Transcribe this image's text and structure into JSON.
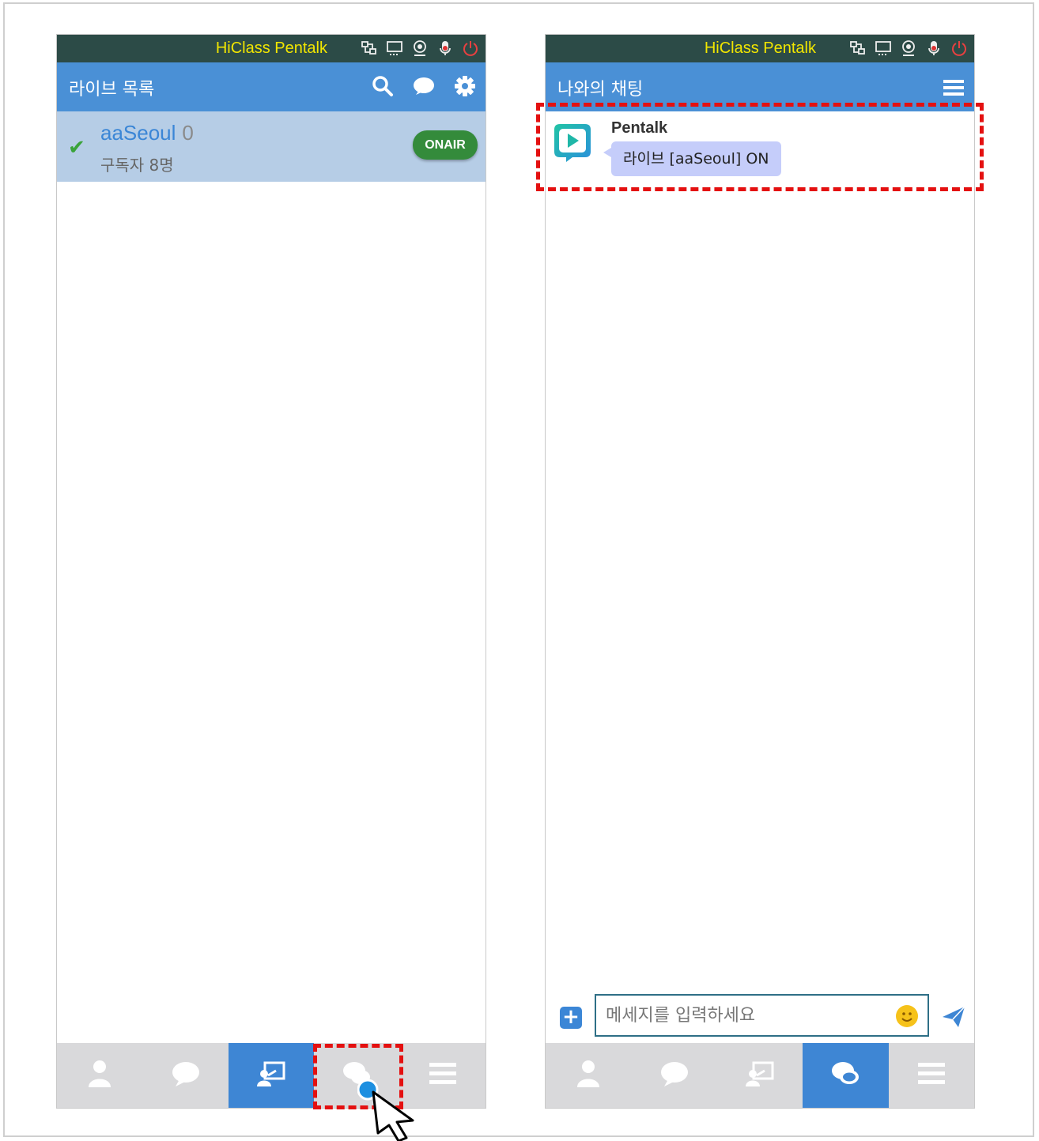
{
  "left_panel": {
    "app_title": "HiClass Pentalk",
    "header_title": "라이브 목록",
    "live_items": [
      {
        "name": "aaSeoul",
        "count": "0",
        "subscribers": "구독자 8명",
        "badge": "ONAIR"
      }
    ],
    "nav": [
      "person-icon",
      "chat-bubble-icon",
      "live-board-icon",
      "chat-icon",
      "menu-icon"
    ],
    "active_nav": "live-board-icon"
  },
  "right_panel": {
    "app_title": "HiClass Pentalk",
    "header_title": "나와의 채팅",
    "messages": [
      {
        "sender": "Pentalk",
        "text": "라이브 [aaSeoul] ON"
      }
    ],
    "input": {
      "placeholder": "메세지를 입력하세요",
      "value": ""
    },
    "nav": [
      "person-icon",
      "chat-bubble-icon",
      "live-board-icon",
      "chat-icon",
      "menu-icon"
    ],
    "active_nav": "chat-icon"
  },
  "colors": {
    "topbar": "#2c4b47",
    "header": "#4a90d6",
    "title_text": "#f2e600",
    "selected_row": "#b6cde6",
    "onair": "#348b3b",
    "highlight": "#e41010",
    "bubble": "#c5cdfa"
  }
}
